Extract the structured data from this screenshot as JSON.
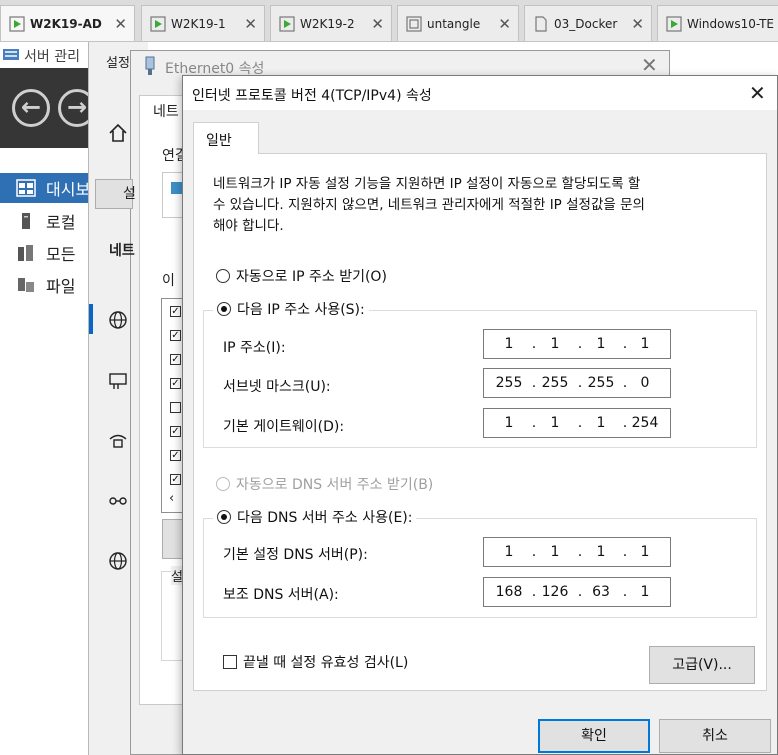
{
  "vm_tabs": [
    {
      "label": "W2K19-AD",
      "active": true
    },
    {
      "label": "W2K19-1",
      "active": false
    },
    {
      "label": "W2K19-2",
      "active": false
    },
    {
      "label": "untangle",
      "active": false
    },
    {
      "label": "03_Docker",
      "active": false
    },
    {
      "label": "Windows10-TE",
      "active": false
    }
  ],
  "server_manager": {
    "title": "서버 관리",
    "sidebar": [
      {
        "label": "대시보",
        "selected": true
      },
      {
        "label": "로컬",
        "selected": false
      },
      {
        "label": "모든",
        "selected": false
      },
      {
        "label": "파일",
        "selected": false
      }
    ]
  },
  "settings_window": {
    "title": "설정",
    "tab_fragment": "네트",
    "heading_fragment": "연결",
    "button_fragment": "설",
    "network_fragment": "네트",
    "items_fragment": "이",
    "desc_fragment": "설"
  },
  "ethernet_window": {
    "title": "Ethernet0 속성"
  },
  "dialog": {
    "title": "인터넷 프로토콜 버전 4(TCP/IPv4) 속성",
    "tab_general": "일반",
    "description_lines": [
      "네트워크가 IP 자동 설정 기능을 지원하면 IP 설정이 자동으로 할당되도록 할",
      "수 있습니다. 지원하지 않으면, 네트워크 관리자에게 적절한 IP 설정값을 문의",
      "해야 합니다."
    ],
    "ip_auto_label": "자동으로 IP 주소 받기(O)",
    "ip_manual_label": "다음 IP 주소 사용(S):",
    "ip_address_label": "IP 주소(I):",
    "ip_address": [
      "1",
      "1",
      "1",
      "1"
    ],
    "subnet_label": "서브넷 마스크(U):",
    "subnet": [
      "255",
      "255",
      "255",
      "0"
    ],
    "gateway_label": "기본 게이트웨이(D):",
    "gateway": [
      "1",
      "1",
      "1",
      "254"
    ],
    "dns_auto_label": "자동으로 DNS 서버 주소 받기(B)",
    "dns_manual_label": "다음 DNS 서버 주소 사용(E):",
    "dns_preferred_label": "기본 설정 DNS 서버(P):",
    "dns_preferred": [
      "1",
      "1",
      "1",
      "1"
    ],
    "dns_alternate_label": "보조 DNS 서버(A):",
    "dns_alternate": [
      "168",
      "126",
      "63",
      "1"
    ],
    "validate_label": "끝낼 때 설정 유효성 검사(L)",
    "advanced_button": "고급(V)...",
    "ok_button": "확인",
    "cancel_button": "취소",
    "ip_mode": "manual",
    "dns_mode": "manual",
    "validate_checked": false
  },
  "colors": {
    "accent": "#0078d7",
    "sidebar_selected": "#2f6fb3",
    "banner": "#363636"
  }
}
